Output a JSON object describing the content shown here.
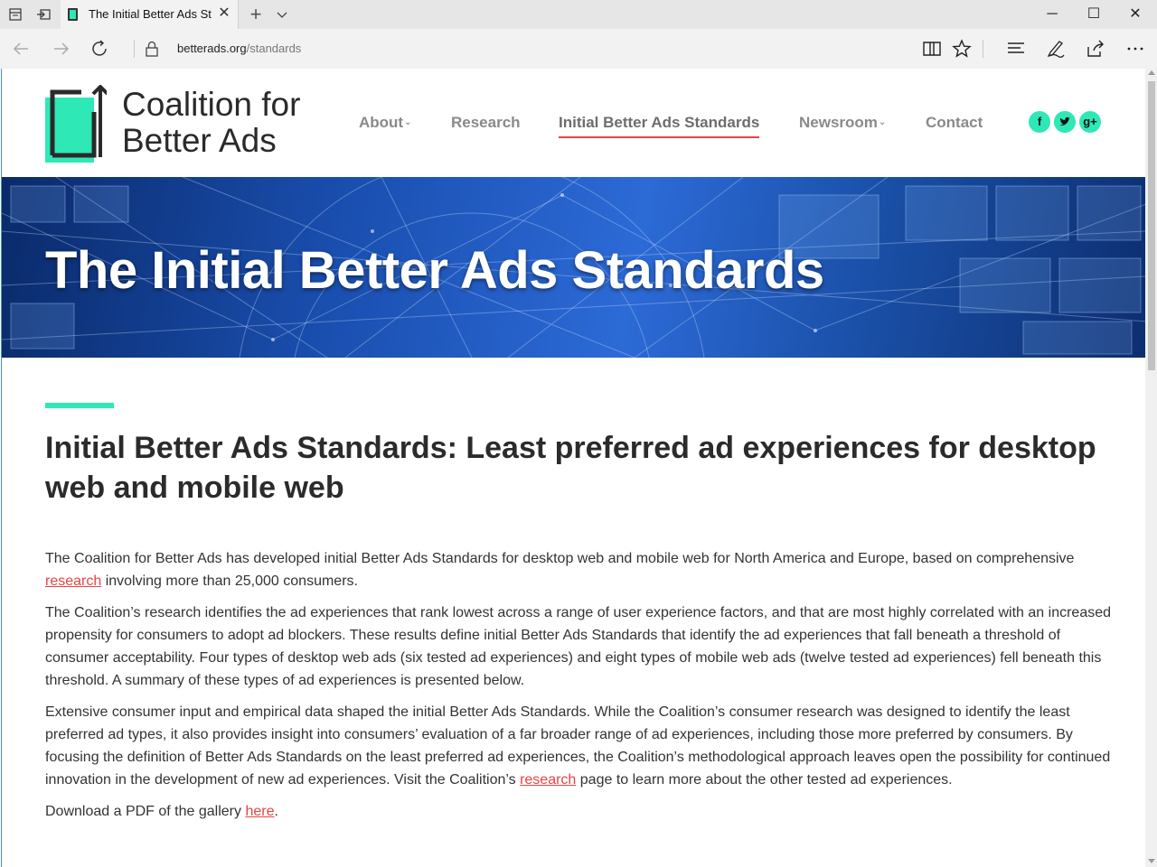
{
  "browser": {
    "tab_title": "The Initial Better Ads St",
    "url_domain": "betterads.org",
    "url_path": "/standards"
  },
  "site": {
    "logo_line1": "Coalition for",
    "logo_line2": "Better Ads",
    "nav": {
      "about": "About",
      "research": "Research",
      "standards": "Initial Better Ads Standards",
      "newsroom": "Newsroom",
      "contact": "Contact"
    },
    "social": {
      "facebook": "f",
      "google_plus": "g+"
    }
  },
  "hero": {
    "title": "The Initial Better Ads Standards"
  },
  "content": {
    "heading": "Initial Better Ads Standards: Least preferred ad experiences for desktop web and mobile web",
    "p1_text": "The Coalition for Better Ads has developed initial Better Ads Standards for desktop web and mobile web for North America and Europe, based on comprehensive ",
    "p1_link": "research",
    "p1_tail": " involving more than 25,000 consumers.",
    "p2": "The Coalition’s research identifies the ad experiences that rank lowest across a range of user experience factors, and that are most highly correlated with an increased propensity for consumers to adopt ad blockers. These results define initial Better Ads Standards that identify the ad experiences that fall beneath a threshold of consumer acceptability. Four types of desktop web ads (six tested ad experiences) and eight types of mobile web ads (twelve tested ad experiences) fell beneath this threshold. A summary of these types of ad experiences is presented below.",
    "p3_text": "Extensive consumer input and empirical data shaped the initial Better Ads Standards. While the Coalition’s consumer research was designed to identify the least preferred ad types, it also provides insight into consumers’ evaluation of a far broader range of ad experiences, including those more preferred by consumers. By focusing the definition of Better Ads Standards on the least preferred ad experiences, the Coalition’s methodological approach leaves open the possibility for continued innovation in the development of new ad experiences. Visit the Coalition’s ",
    "p3_link": "research",
    "p3_tail": " page to learn more about the other tested ad experiences.",
    "p4_text": "Download a PDF of the gallery ",
    "p4_link": "here",
    "p4_tail": "."
  },
  "colors": {
    "accent": "#2ee8b6",
    "link": "#e94343",
    "text": "#2b2b2b"
  }
}
